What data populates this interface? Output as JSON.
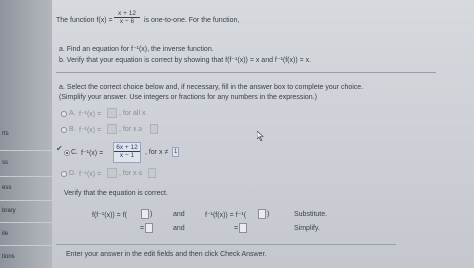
{
  "sidebar": {
    "items": [
      "rts",
      "ss",
      "ess",
      "brary",
      "ile",
      "tions"
    ]
  },
  "question": {
    "intro_a": "The function f(x) =",
    "f_num": "x + 12",
    "f_den": "x − 6",
    "intro_b": "is one-to-one. For the function,",
    "part_a": "a. Find an equation for f⁻¹(x), the inverse function.",
    "part_b": "b. Verify that your equation is correct by showing that f(f⁻¹(x)) = x and f⁻¹(f(x)) = x."
  },
  "instruction": {
    "line1": "a. Select the correct choice below and, if necessary, fill in the answer box to complete your choice.",
    "line2": "(Simplify your answer. Use integers or fractions for any numbers in the expression.)"
  },
  "choices": [
    {
      "letter": "A.",
      "lhs": "f⁻¹(x) =",
      "suffix": ", for all x",
      "selected": false
    },
    {
      "letter": "B.",
      "lhs": "f⁻¹(x) =",
      "suffix": ", for x ≥",
      "selected": false
    },
    {
      "letter": "C.",
      "lhs": "f⁻¹(x) =",
      "ans_num": "6x + 12",
      "ans_den": "x − 1",
      "suffix": ", for x ≠",
      "ans_excl": "1",
      "selected": true
    },
    {
      "letter": "D.",
      "lhs": "f⁻¹(x) =",
      "suffix": ", for x ≤",
      "selected": false
    }
  ],
  "verify": {
    "heading": "Verify that the equation is correct.",
    "left_expr": "f(f⁻¹(x)) = f(",
    "and1": "and",
    "and2": "and",
    "right_expr": "f⁻¹(f(x)) = f⁻¹(",
    "eq1": "=",
    "eq2": "=",
    "close1": ")",
    "close2": ")",
    "step1": "Substitute.",
    "step2": "Simplify."
  },
  "footer": {
    "text": "Enter your answer in the edit fields and then click Check Answer."
  }
}
